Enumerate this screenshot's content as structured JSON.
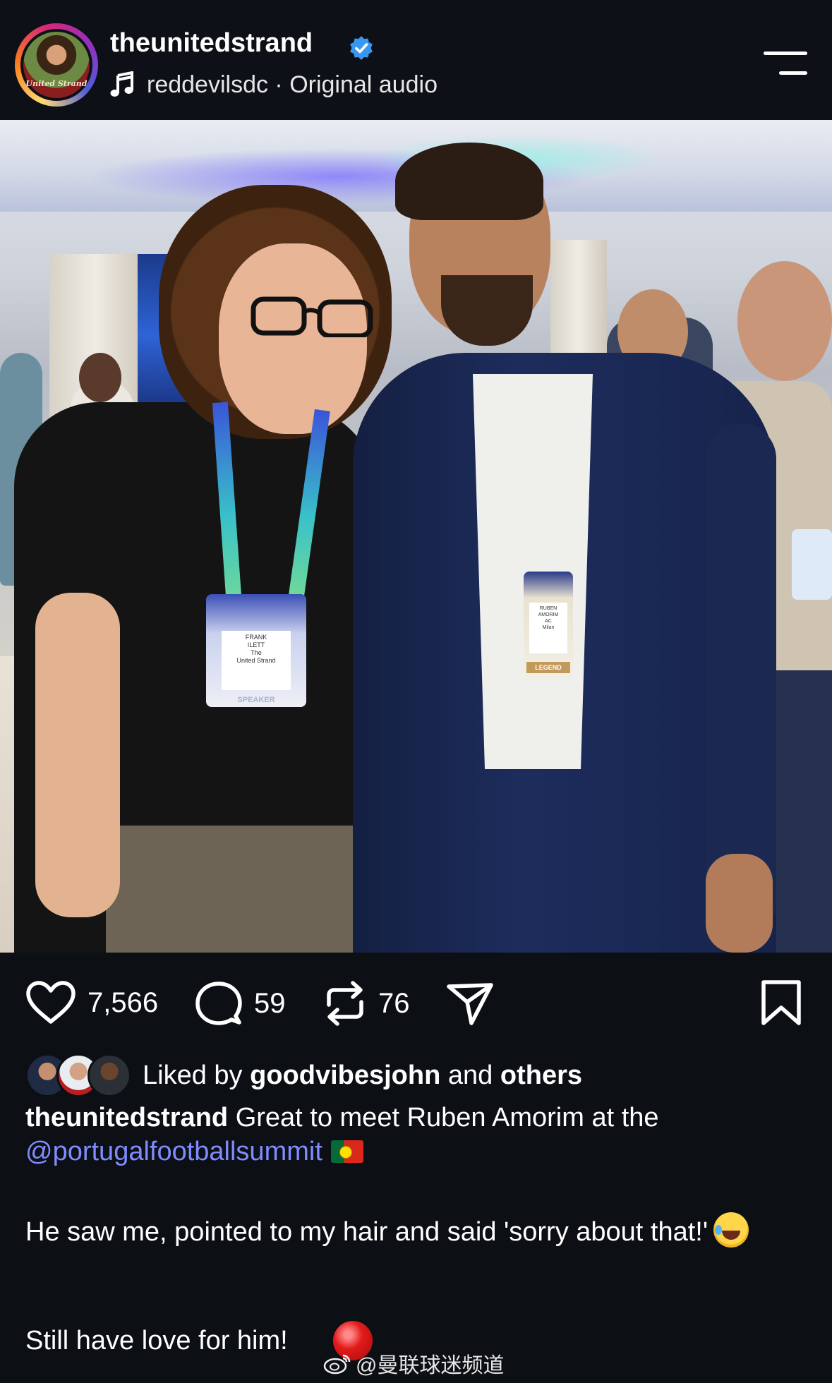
{
  "header": {
    "username": "theunitedstrand",
    "audio_text": "reddevilsdc · Original audio",
    "avatar_badge_text": "United Strand"
  },
  "photo": {
    "badge_left_lines": [
      "FRANK",
      "ILETT",
      "The",
      "United Strand",
      "SPEAKER"
    ],
    "badge_right_lines": [
      "RUBEN",
      "AMORIM",
      "AC",
      "Milan",
      "LEGEND"
    ]
  },
  "actions": {
    "likes": "7,566",
    "comments": "59",
    "reposts": "76"
  },
  "liked_by": {
    "prefix": "Liked by",
    "user": "goodvibesjohn",
    "middle": "and",
    "suffix": "others"
  },
  "caption": {
    "username": "theunitedstrand",
    "text": "Great to meet Ruben Amorim at the",
    "mention": "@portugalfootballsummit",
    "line2": "He saw me, pointed to my hair and said 'sorry about that!'",
    "line3": "Still have love for him!"
  },
  "watermark": "@曼联球迷频道",
  "colors": {
    "background": "#0c0f14",
    "mention": "#7f8cff",
    "verified": "#3897f0"
  }
}
